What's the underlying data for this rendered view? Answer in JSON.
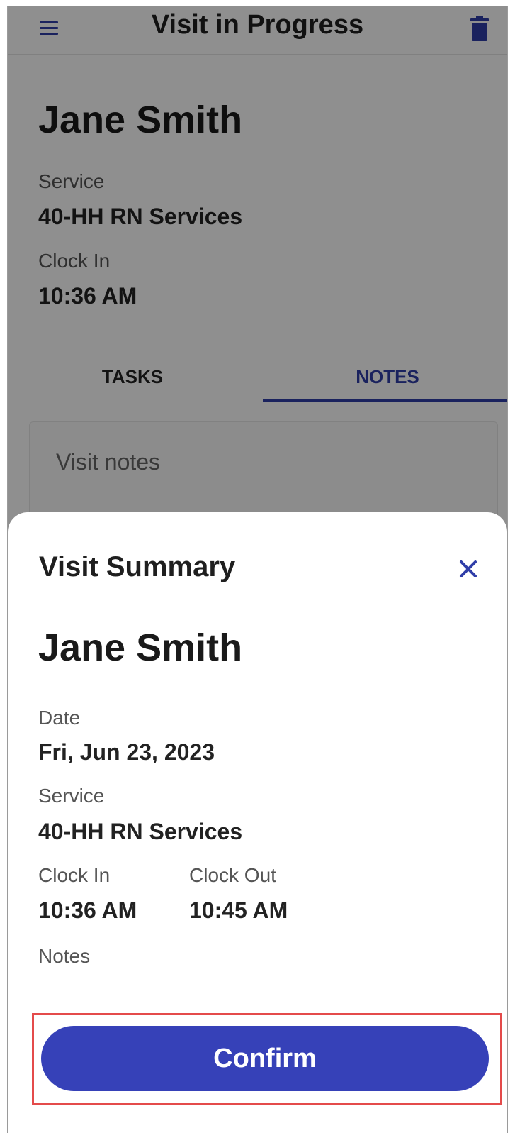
{
  "appbar": {
    "title": "Visit in Progress",
    "menu_icon": "hamburger-menu-icon",
    "trash_icon": "trash-icon"
  },
  "visit": {
    "client_name": "Jane Smith",
    "service_label": "Service",
    "service_value": "40-HH RN Services",
    "clock_in_label": "Clock In",
    "clock_in_value": "10:36 AM"
  },
  "tabs": [
    {
      "label": "TASKS",
      "active": false
    },
    {
      "label": "NOTES",
      "active": true
    }
  ],
  "notes": {
    "placeholder": "Visit notes"
  },
  "summary": {
    "title": "Visit Summary",
    "close_icon": "close-icon",
    "client_name": "Jane Smith",
    "date_label": "Date",
    "date_value": "Fri, Jun 23, 2023",
    "service_label": "Service",
    "service_value": "40-HH RN Services",
    "clock_in_label": "Clock In",
    "clock_in_value": "10:36 AM",
    "clock_out_label": "Clock Out",
    "clock_out_value": "10:45 AM",
    "notes_label": "Notes",
    "confirm_label": "Confirm"
  },
  "colors": {
    "accent": "#3641b8",
    "highlight_border": "#e44b4b"
  }
}
